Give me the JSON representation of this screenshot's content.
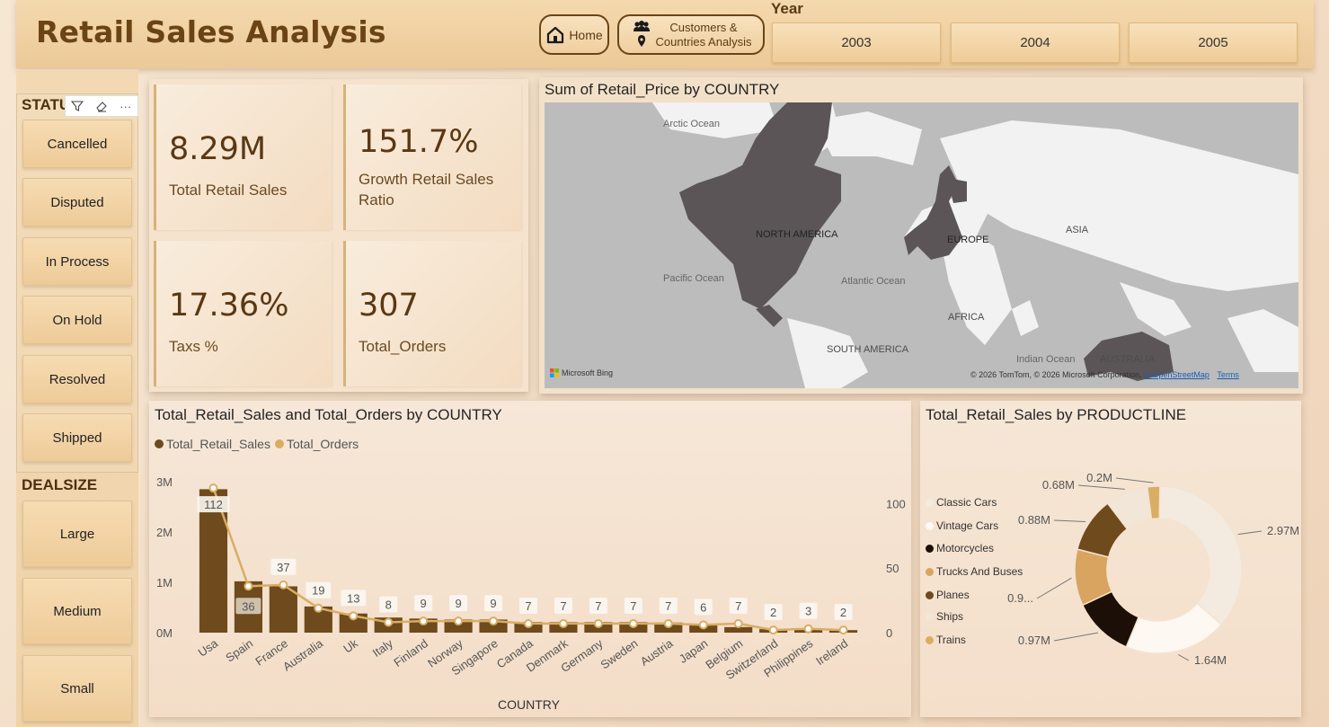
{
  "header": {
    "title": "Retail Sales Analysis",
    "home_label": "Home",
    "customers_label_line1": "Customers &",
    "customers_label_line2": "Countries Analysis",
    "year_label": "Year",
    "years": [
      "2003",
      "2004",
      "2005"
    ]
  },
  "slicers": {
    "status_title": "STATU",
    "status_items": [
      "Cancelled",
      "Disputed",
      "In Process",
      "On Hold",
      "Resolved",
      "Shipped"
    ],
    "dealsize_title": "DEALSIZE",
    "dealsize_items": [
      "Large",
      "Medium",
      "Small"
    ],
    "tools": [
      "filter-icon",
      "eraser-icon",
      "more-icon"
    ],
    "more_glyph": "···"
  },
  "kpis": [
    {
      "value": "8.29M",
      "label": "Total Retail Sales"
    },
    {
      "value": "151.7%",
      "label": "Growth Retail Sales Ratio"
    },
    {
      "value": "17.36%",
      "label": "Taxs %"
    },
    {
      "value": "307",
      "label": "Total_Orders"
    }
  ],
  "map": {
    "title": "Sum of Retail_Price by COUNTRY",
    "labels": {
      "arctic": "Arctic Ocean",
      "north_america": "NORTH AMERICA",
      "europe": "EUROPE",
      "asia": "ASIA",
      "pacific": "Pacific Ocean",
      "atlantic": "Atlantic Ocean",
      "africa": "AFRICA",
      "south_america": "SOUTH AMERICA",
      "indian": "Indian Ocean",
      "australia": "AUSTRALIA"
    },
    "bing": "Microsoft Bing",
    "credit": "© 2026 TomTom, © 2026 Microsoft Corporation,",
    "osm": "© OpenStreetMap",
    "terms": "Terms"
  },
  "combo": {
    "title": "Total_Retail_Sales and Total_Orders by COUNTRY",
    "legend_sales": "Total_Retail_Sales",
    "legend_orders": "Total_Orders",
    "xlabel": "COUNTRY",
    "colors": {
      "bar": "#6e4a1c",
      "line": "#d9ad62"
    }
  },
  "donut": {
    "title": "Total_Retail_Sales by PRODUCTLINE",
    "legend": [
      {
        "name": "Classic Cars",
        "color": "#f3ebe0"
      },
      {
        "name": "Vintage Cars",
        "color": "#fdf9f2"
      },
      {
        "name": "Motorcycles",
        "color": "#1c0f08"
      },
      {
        "name": "Trucks And Buses",
        "color": "#d8a460"
      },
      {
        "name": "Planes",
        "color": "#6e4a1c"
      },
      {
        "name": "Ships",
        "color": "#f1e6d8"
      },
      {
        "name": "Trains",
        "color": "#d9ad62"
      }
    ]
  },
  "chart_data": [
    {
      "type": "bar",
      "title": "Total_Retail_Sales and Total_Orders by COUNTRY",
      "xlabel": "COUNTRY",
      "ylabel": "",
      "categories": [
        "Usa",
        "Spain",
        "France",
        "Australia",
        "Uk",
        "Italy",
        "Finland",
        "Norway",
        "Singapore",
        "Canada",
        "Denmark",
        "Germany",
        "Sweden",
        "Austria",
        "Japan",
        "Belgium",
        "Switzerland",
        "Philippines",
        "Ireland"
      ],
      "series": [
        {
          "name": "Total_Retail_Sales",
          "type": "bar",
          "axis": "left",
          "values": [
            2.85,
            1.02,
            0.92,
            0.52,
            0.38,
            0.3,
            0.28,
            0.26,
            0.26,
            0.21,
            0.21,
            0.21,
            0.21,
            0.2,
            0.17,
            0.11,
            0.07,
            0.08,
            0.05
          ]
        },
        {
          "name": "Total_Orders",
          "type": "line",
          "axis": "right",
          "values": [
            112,
            36,
            37,
            19,
            13,
            8,
            9,
            9,
            9,
            7,
            7,
            7,
            7,
            7,
            6,
            7,
            2,
            3,
            2
          ]
        }
      ],
      "ytick_labels_left": [
        "0M",
        "1M",
        "2M",
        "3M"
      ],
      "yticks_left": [
        0,
        1,
        2,
        3
      ],
      "ylim_left": [
        0,
        3.0
      ],
      "yticks_right": [
        0,
        50,
        100
      ],
      "ylim_right": [
        0,
        117
      ],
      "grid": false,
      "legend": "top-left"
    },
    {
      "type": "pie",
      "title": "Total_Retail_Sales by PRODUCTLINE",
      "categories": [
        "Classic Cars",
        "Vintage Cars",
        "Motorcycles",
        "Trucks And Buses",
        "Planes",
        "Ships",
        "Trains"
      ],
      "values": [
        2.97,
        1.64,
        0.97,
        0.9,
        0.88,
        0.68,
        0.2
      ],
      "data_labels": [
        "2.97M",
        "1.64M",
        "0.97M",
        "0.9...",
        "0.88M",
        "0.68M",
        "0.2M"
      ],
      "donut": true,
      "legend": "left"
    }
  ]
}
